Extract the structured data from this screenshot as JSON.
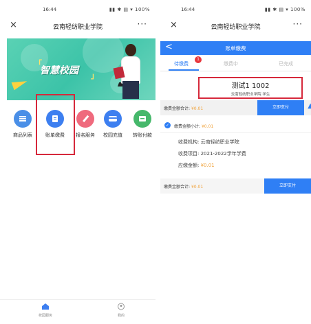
{
  "left_phone": {
    "status_time": "16:44",
    "app_title": "云南轻纺职业学院",
    "close_glyph": "×",
    "more_glyph": "···",
    "banner": {
      "slogan": "智慧校园"
    },
    "grid_items": [
      {
        "label": "商品列表",
        "icon": "list-icon",
        "color": "#4a8fe7"
      },
      {
        "label": "账单缴费",
        "icon": "bill-icon",
        "color": "#3d7ff0"
      },
      {
        "label": "报名服务",
        "icon": "pen-icon",
        "color": "#ef6a7d"
      },
      {
        "label": "校园充值",
        "icon": "card-icon",
        "color": "#3d7ff0"
      },
      {
        "label": "转账付款",
        "icon": "wallet-icon",
        "color": "#46b86b"
      }
    ],
    "tabbar": [
      {
        "label": "校园服务",
        "icon": "home-icon"
      },
      {
        "label": "我的",
        "icon": "profile-icon"
      }
    ]
  },
  "right_phone": {
    "status_time": "16:44",
    "app_title": "云南轻纺职业学院",
    "close_glyph": "×",
    "more_glyph": "···",
    "page_title": "账单缴费",
    "back_glyph": "<",
    "tabs": [
      {
        "label": "待缴费",
        "badge": "1"
      },
      {
        "label": "缴费中"
      },
      {
        "label": "已完成"
      }
    ],
    "user": {
      "name": "测试1   1002",
      "org": "云南轻纺职业学院 学生"
    },
    "total_label": "缴费金额合计:",
    "total_amount": "¥0.01",
    "pay_button": "立即支付",
    "subtotal_label": "缴费金额小计:",
    "subtotal_amount": "¥0.01",
    "details": [
      {
        "label": "收费机构:",
        "value": "云南轻纺职业学院"
      },
      {
        "label": "收费项目:",
        "value": "2021-2022学年学费"
      },
      {
        "label": "应缴金额:",
        "value": "¥0.01"
      }
    ],
    "accent_color": "#2f7ff5",
    "amount_color": "#f0a23a"
  }
}
